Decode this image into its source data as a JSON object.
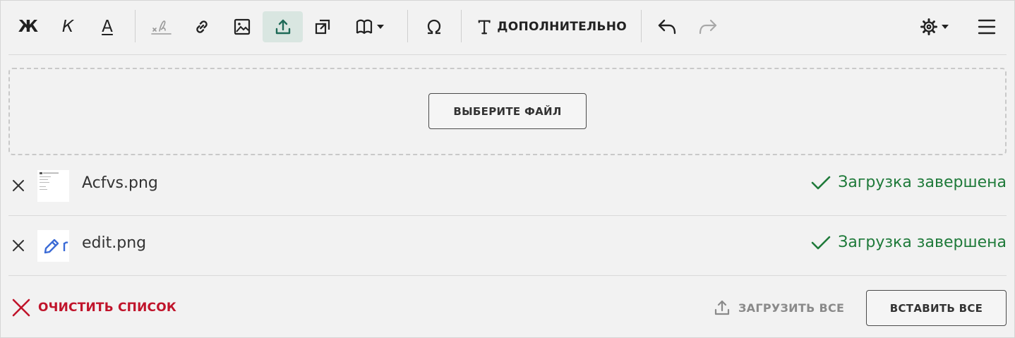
{
  "toolbar": {
    "bold_label": "Ж",
    "italic_label": "К",
    "text_color_label": "А",
    "more_label": "ДОПОЛНИТЕЛЬНО"
  },
  "dropzone": {
    "choose_file_label": "ВЫБЕРИТЕ ФАЙЛ"
  },
  "files": [
    {
      "name": "Acfvs.png",
      "status": "Загрузка завершена"
    },
    {
      "name": "edit.png",
      "status": "Загрузка завершена"
    }
  ],
  "footer": {
    "clear_label": "ОЧИСТИТЬ СПИСОК",
    "upload_all_label": "ЗАГРУЗИТЬ ВСЕ",
    "insert_all_label": "ВСТАВИТЬ ВСЕ"
  },
  "colors": {
    "success": "#1f7a3a",
    "danger": "#c0142b",
    "active_tool_bg": "#d9e6e1"
  }
}
